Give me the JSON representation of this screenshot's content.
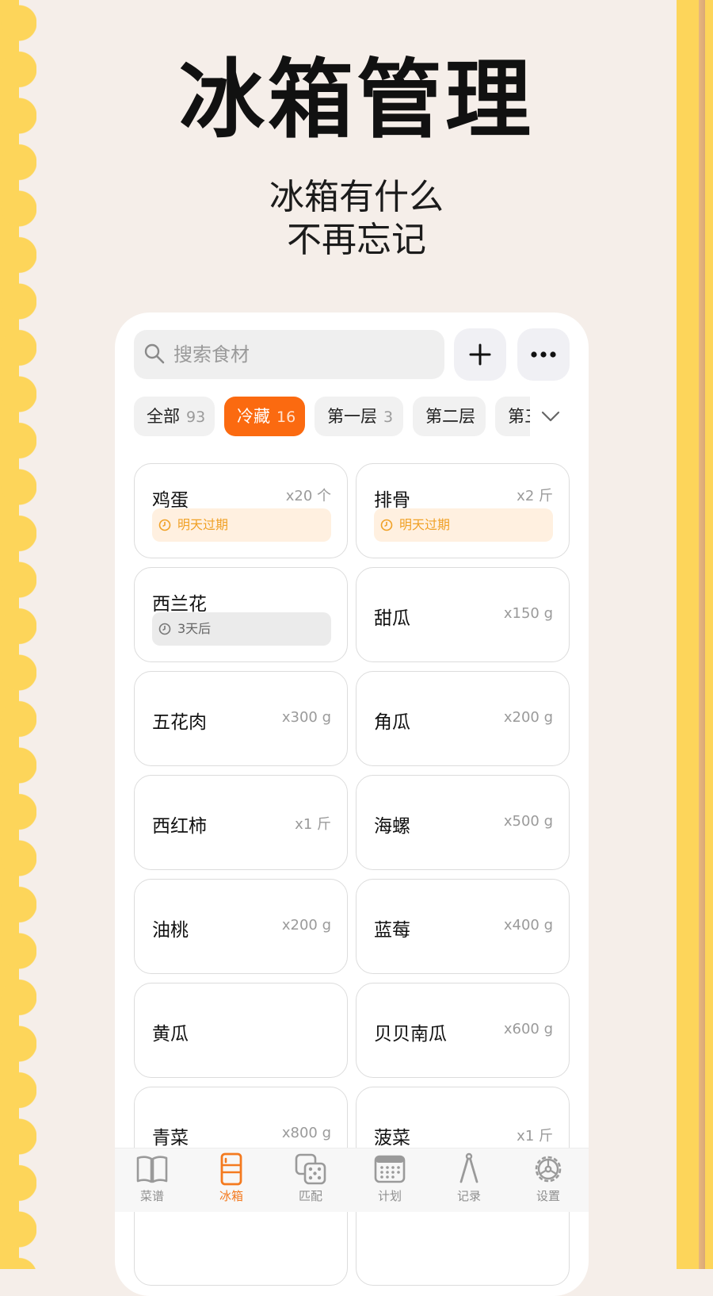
{
  "hero": {
    "title": "冰箱管理",
    "subtitle_line1": "冰箱有什么",
    "subtitle_line2": "不再忘记"
  },
  "search": {
    "placeholder": "搜索食材",
    "icon": "search-icon"
  },
  "actions": {
    "add_icon": "plus-icon",
    "more_icon": "more-dots-icon"
  },
  "tabs": [
    {
      "label": "全部",
      "count": "93",
      "active": false
    },
    {
      "label": "冷藏",
      "count": "16",
      "active": true
    },
    {
      "label": "第一层",
      "count": "3",
      "active": false
    },
    {
      "label": "第二层",
      "count": "",
      "active": false
    },
    {
      "label": "第三",
      "count": "",
      "active": false
    }
  ],
  "items": [
    {
      "name": "鸡蛋",
      "qty": "x20 个",
      "tag": "明天过期"
    },
    {
      "name": "排骨",
      "qty": "x2 斤",
      "tag": "明天过期"
    },
    {
      "name": "西兰花",
      "qty": "",
      "tag": "3天后"
    },
    {
      "name": "甜瓜",
      "qty": "x150 g"
    },
    {
      "name": "五花肉",
      "qty": "x300 g"
    },
    {
      "name": "角瓜",
      "qty": "x200 g"
    },
    {
      "name": "西红柿",
      "qty": "x1 斤"
    },
    {
      "name": "海螺",
      "qty": "x500 g"
    },
    {
      "name": "油桃",
      "qty": "x200 g"
    },
    {
      "name": "蓝莓",
      "qty": "x400 g"
    },
    {
      "name": "黄瓜",
      "qty": ""
    },
    {
      "name": "贝贝南瓜",
      "qty": "x600 g"
    },
    {
      "name": "青菜",
      "qty": "x800 g"
    },
    {
      "name": "菠菜",
      "qty": "x1 斤"
    }
  ],
  "nav": [
    {
      "label": "菜谱",
      "icon": "book-icon",
      "active": false
    },
    {
      "label": "冰箱",
      "icon": "fridge-icon",
      "active": true
    },
    {
      "label": "匹配",
      "icon": "dice-icon",
      "active": false
    },
    {
      "label": "计划",
      "icon": "calendar-icon",
      "active": false
    },
    {
      "label": "记录",
      "icon": "compass-icon",
      "active": false
    },
    {
      "label": "设置",
      "icon": "gear-icon",
      "active": false
    }
  ],
  "colors": {
    "accent": "#fb6a10",
    "warning": "#f0a126",
    "background": "#f5eee9",
    "frame": "#fdd55a"
  }
}
